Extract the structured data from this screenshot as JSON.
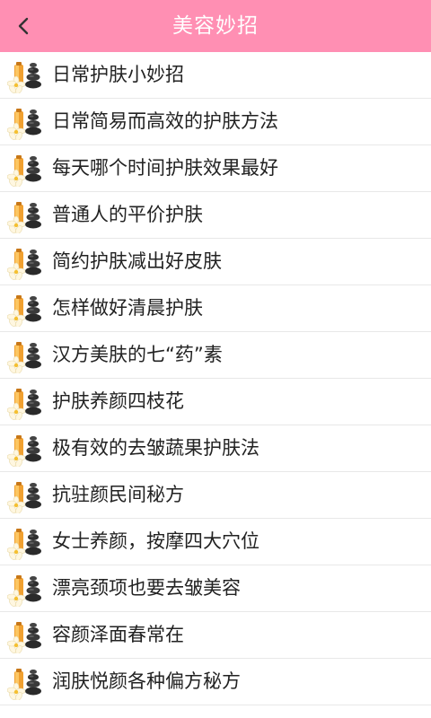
{
  "header": {
    "title": "美容妙招",
    "back_icon": "chevron-left-icon",
    "background_color": "#ff8fb3"
  },
  "list": {
    "item_icon": "spa-stones-flower-icon",
    "items": [
      {
        "label": "日常护肤小妙招"
      },
      {
        "label": "日常简易而高效的护肤方法"
      },
      {
        "label": "每天哪个时间护肤效果最好"
      },
      {
        "label": "普通人的平价护肤"
      },
      {
        "label": "简约护肤减出好皮肤"
      },
      {
        "label": "怎样做好清晨护肤"
      },
      {
        "label": "汉方美肤的七“药”素"
      },
      {
        "label": "护肤养颜四枝花"
      },
      {
        "label": "极有效的去皱蔬果护肤法"
      },
      {
        "label": "抗驻颜民间秘方"
      },
      {
        "label": "女士养颜，按摩四大穴位"
      },
      {
        "label": "漂亮颈项也要去皱美容"
      },
      {
        "label": "容颜泽面春常在"
      },
      {
        "label": "润肤悦颜各种偏方秘方"
      }
    ]
  }
}
